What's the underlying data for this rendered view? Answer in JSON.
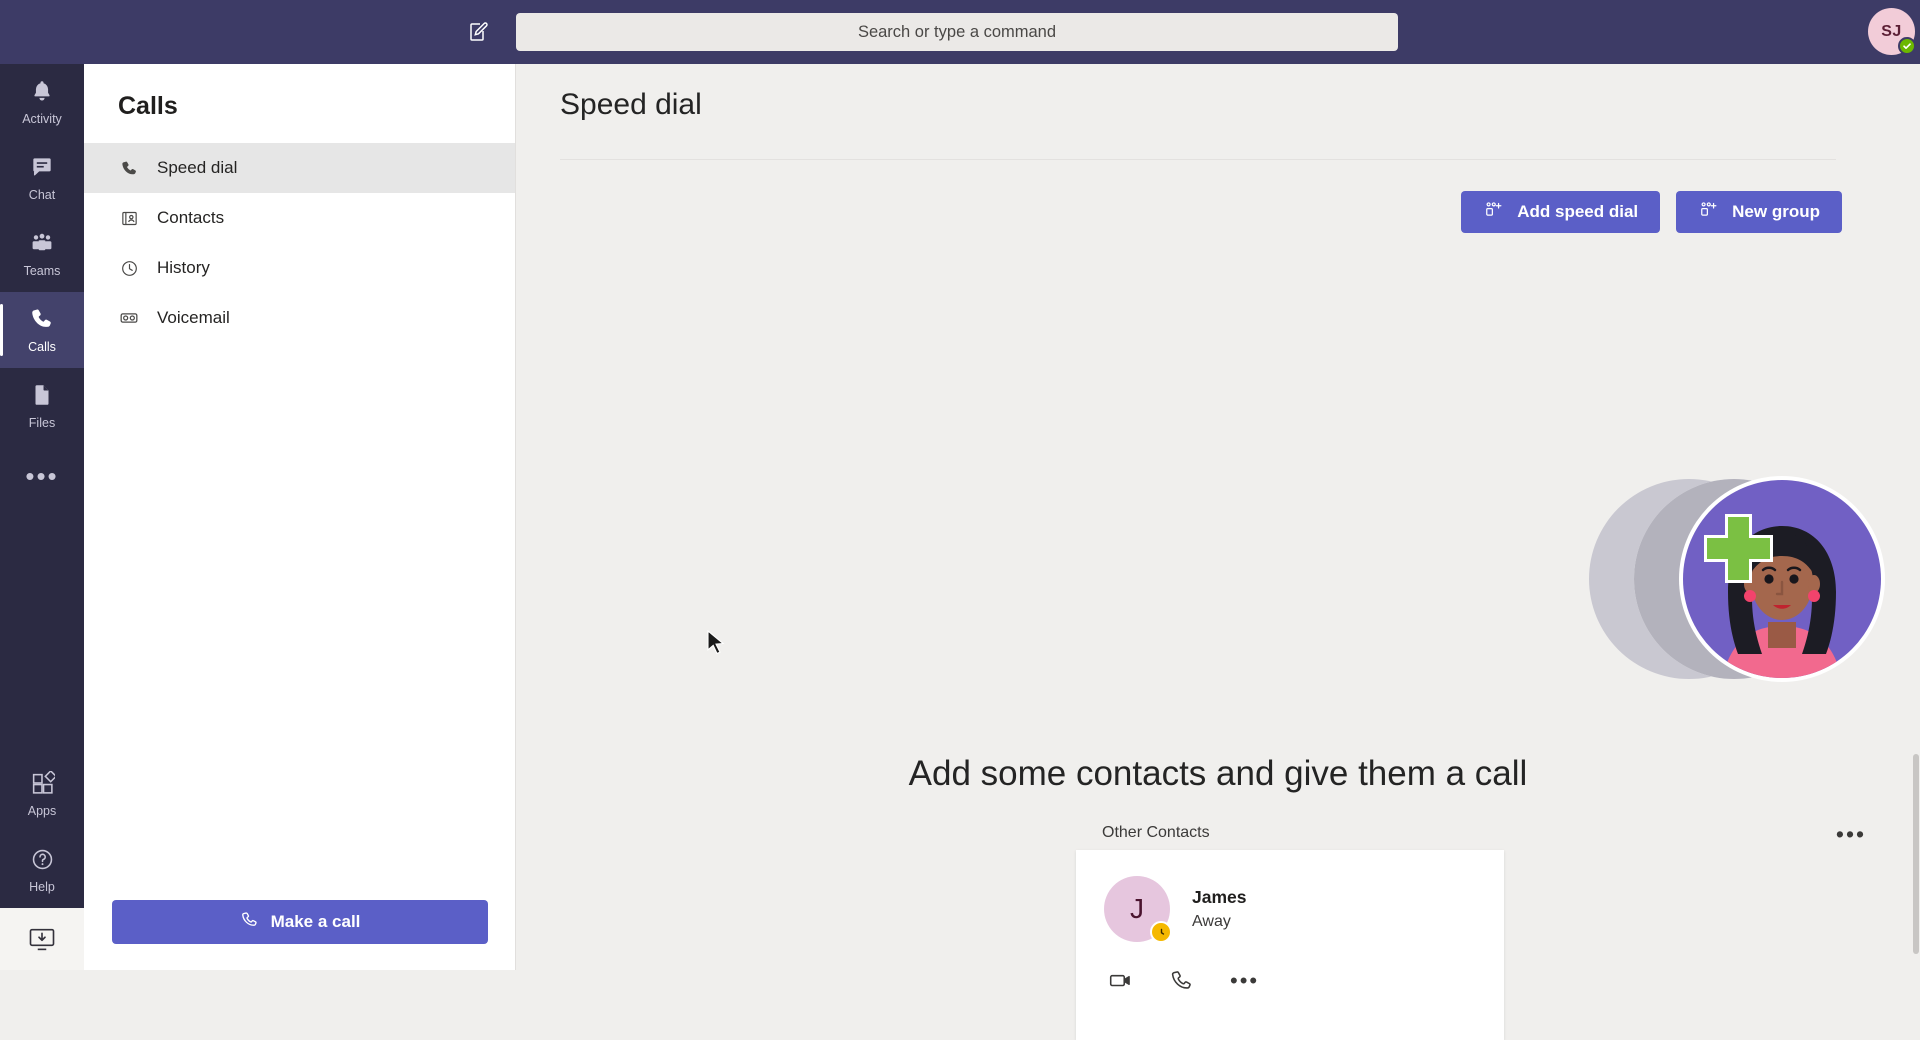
{
  "topbar": {
    "compose_icon": "compose-icon",
    "search": {
      "placeholder": "Search or type a command",
      "value": ""
    },
    "avatar": {
      "initials": "SJ",
      "presence": "available",
      "presence_color": "#6bb700"
    }
  },
  "rail": {
    "items": [
      {
        "label": "Activity",
        "icon": "bell-icon",
        "active": false
      },
      {
        "label": "Chat",
        "icon": "chat-icon",
        "active": false
      },
      {
        "label": "Teams",
        "icon": "teams-icon",
        "active": false
      },
      {
        "label": "Calls",
        "icon": "phone-icon",
        "active": true
      },
      {
        "label": "Files",
        "icon": "file-icon",
        "active": false
      }
    ],
    "more_label": "•••",
    "bottom": [
      {
        "label": "Apps",
        "icon": "apps-icon"
      },
      {
        "label": "Help",
        "icon": "help-icon"
      }
    ],
    "download_icon": "download-app-icon"
  },
  "sidebar": {
    "title": "Calls",
    "items": [
      {
        "label": "Speed dial",
        "icon": "phone-icon",
        "active": true
      },
      {
        "label": "Contacts",
        "icon": "contact-card-icon",
        "active": false
      },
      {
        "label": "History",
        "icon": "clock-icon",
        "active": false
      },
      {
        "label": "Voicemail",
        "icon": "voicemail-icon",
        "active": false
      }
    ],
    "make_call_label": "Make a call",
    "make_call_icon": "phone-icon"
  },
  "main": {
    "title": "Speed dial",
    "actions": [
      {
        "label": "Add speed dial",
        "icon": "add-person-icon"
      },
      {
        "label": "New group",
        "icon": "add-person-icon"
      }
    ],
    "empty_state": {
      "headline": "Add some contacts and give them a call",
      "illustration": "contacts-avatars-illustration"
    },
    "more_label": "•••"
  },
  "overlay": {
    "section_label": "Other Contacts",
    "contact": {
      "initial": "J",
      "name": "James",
      "status": "Away",
      "status_badge": "clock-icon",
      "status_badge_color": "#f5b800",
      "avatar_color": "#e6c6de",
      "actions": [
        {
          "icon": "video-call-icon",
          "name": "video-call"
        },
        {
          "icon": "audio-call-icon",
          "name": "audio-call"
        },
        {
          "icon": "more-icon",
          "name": "more-options",
          "label": "•••"
        }
      ]
    }
  },
  "theme": {
    "accent": "#5b5fc7",
    "topbar_bg": "#3d3b66",
    "rail_bg": "#2b2a42",
    "main_bg": "#f0efed"
  }
}
